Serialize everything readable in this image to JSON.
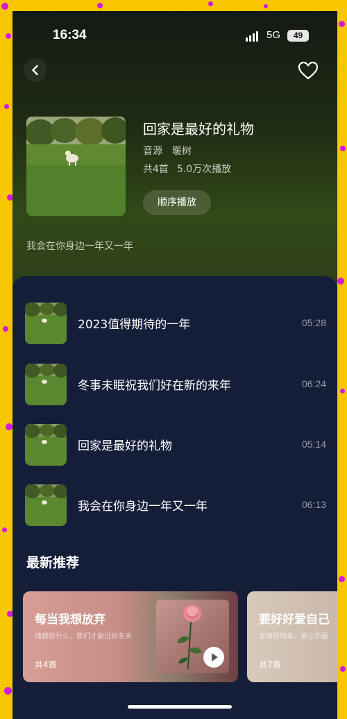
{
  "status": {
    "time": "16:34",
    "network": "5G",
    "battery": "49"
  },
  "album": {
    "title": "回家是最好的礼物",
    "source_label": "音源",
    "source_name": "暖树",
    "track_count": "共4首",
    "plays": "5.0万次播放",
    "play_button": "顺序播放",
    "description": "我会在你身边一年又一年"
  },
  "tracks": [
    {
      "title": "2023值得期待的一年",
      "duration": "05:28"
    },
    {
      "title": "冬事未眠祝我们好在新的来年",
      "duration": "06:24"
    },
    {
      "title": "回家是最好的礼物",
      "duration": "05:14"
    },
    {
      "title": "我会在你身边一年又一年",
      "duration": "06:13"
    }
  ],
  "recommend": {
    "title": "最新推荐",
    "cards": [
      {
        "title": "每当我想放弃",
        "subtitle": "储藏些什么，我们才能过好冬天",
        "count": "共4首"
      },
      {
        "title": "要好好爱自己",
        "subtitle": "爱情很简单，谁让你最",
        "count": "共7首"
      }
    ]
  },
  "icons": {
    "back": "chevron-left-icon",
    "favorite": "heart-outline-icon",
    "play": "play-icon"
  },
  "colors": {
    "background": "#f7c600",
    "dots": "#d21bd8",
    "panel": "#151e39"
  }
}
